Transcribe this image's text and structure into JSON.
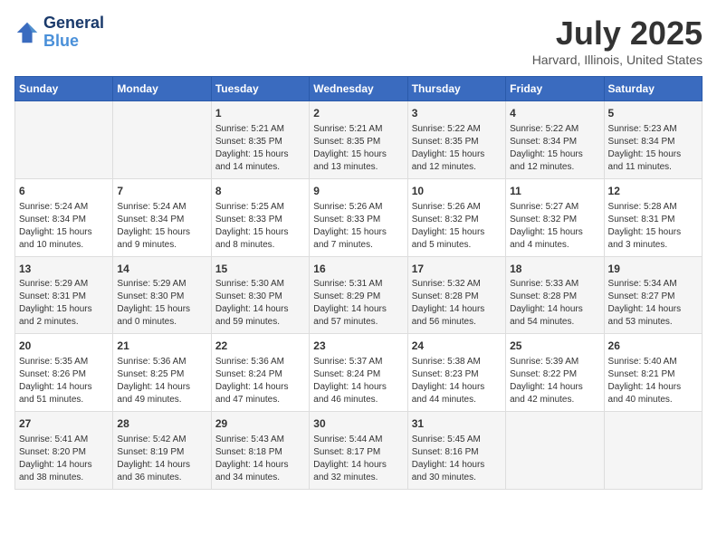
{
  "header": {
    "logo_line1": "General",
    "logo_line2": "Blue",
    "title": "July 2025",
    "subtitle": "Harvard, Illinois, United States"
  },
  "days_of_week": [
    "Sunday",
    "Monday",
    "Tuesday",
    "Wednesday",
    "Thursday",
    "Friday",
    "Saturday"
  ],
  "weeks": [
    [
      {
        "day": "",
        "info": ""
      },
      {
        "day": "",
        "info": ""
      },
      {
        "day": "1",
        "info": "Sunrise: 5:21 AM\nSunset: 8:35 PM\nDaylight: 15 hours\nand 14 minutes."
      },
      {
        "day": "2",
        "info": "Sunrise: 5:21 AM\nSunset: 8:35 PM\nDaylight: 15 hours\nand 13 minutes."
      },
      {
        "day": "3",
        "info": "Sunrise: 5:22 AM\nSunset: 8:35 PM\nDaylight: 15 hours\nand 12 minutes."
      },
      {
        "day": "4",
        "info": "Sunrise: 5:22 AM\nSunset: 8:34 PM\nDaylight: 15 hours\nand 12 minutes."
      },
      {
        "day": "5",
        "info": "Sunrise: 5:23 AM\nSunset: 8:34 PM\nDaylight: 15 hours\nand 11 minutes."
      }
    ],
    [
      {
        "day": "6",
        "info": "Sunrise: 5:24 AM\nSunset: 8:34 PM\nDaylight: 15 hours\nand 10 minutes."
      },
      {
        "day": "7",
        "info": "Sunrise: 5:24 AM\nSunset: 8:34 PM\nDaylight: 15 hours\nand 9 minutes."
      },
      {
        "day": "8",
        "info": "Sunrise: 5:25 AM\nSunset: 8:33 PM\nDaylight: 15 hours\nand 8 minutes."
      },
      {
        "day": "9",
        "info": "Sunrise: 5:26 AM\nSunset: 8:33 PM\nDaylight: 15 hours\nand 7 minutes."
      },
      {
        "day": "10",
        "info": "Sunrise: 5:26 AM\nSunset: 8:32 PM\nDaylight: 15 hours\nand 5 minutes."
      },
      {
        "day": "11",
        "info": "Sunrise: 5:27 AM\nSunset: 8:32 PM\nDaylight: 15 hours\nand 4 minutes."
      },
      {
        "day": "12",
        "info": "Sunrise: 5:28 AM\nSunset: 8:31 PM\nDaylight: 15 hours\nand 3 minutes."
      }
    ],
    [
      {
        "day": "13",
        "info": "Sunrise: 5:29 AM\nSunset: 8:31 PM\nDaylight: 15 hours\nand 2 minutes."
      },
      {
        "day": "14",
        "info": "Sunrise: 5:29 AM\nSunset: 8:30 PM\nDaylight: 15 hours\nand 0 minutes."
      },
      {
        "day": "15",
        "info": "Sunrise: 5:30 AM\nSunset: 8:30 PM\nDaylight: 14 hours\nand 59 minutes."
      },
      {
        "day": "16",
        "info": "Sunrise: 5:31 AM\nSunset: 8:29 PM\nDaylight: 14 hours\nand 57 minutes."
      },
      {
        "day": "17",
        "info": "Sunrise: 5:32 AM\nSunset: 8:28 PM\nDaylight: 14 hours\nand 56 minutes."
      },
      {
        "day": "18",
        "info": "Sunrise: 5:33 AM\nSunset: 8:28 PM\nDaylight: 14 hours\nand 54 minutes."
      },
      {
        "day": "19",
        "info": "Sunrise: 5:34 AM\nSunset: 8:27 PM\nDaylight: 14 hours\nand 53 minutes."
      }
    ],
    [
      {
        "day": "20",
        "info": "Sunrise: 5:35 AM\nSunset: 8:26 PM\nDaylight: 14 hours\nand 51 minutes."
      },
      {
        "day": "21",
        "info": "Sunrise: 5:36 AM\nSunset: 8:25 PM\nDaylight: 14 hours\nand 49 minutes."
      },
      {
        "day": "22",
        "info": "Sunrise: 5:36 AM\nSunset: 8:24 PM\nDaylight: 14 hours\nand 47 minutes."
      },
      {
        "day": "23",
        "info": "Sunrise: 5:37 AM\nSunset: 8:24 PM\nDaylight: 14 hours\nand 46 minutes."
      },
      {
        "day": "24",
        "info": "Sunrise: 5:38 AM\nSunset: 8:23 PM\nDaylight: 14 hours\nand 44 minutes."
      },
      {
        "day": "25",
        "info": "Sunrise: 5:39 AM\nSunset: 8:22 PM\nDaylight: 14 hours\nand 42 minutes."
      },
      {
        "day": "26",
        "info": "Sunrise: 5:40 AM\nSunset: 8:21 PM\nDaylight: 14 hours\nand 40 minutes."
      }
    ],
    [
      {
        "day": "27",
        "info": "Sunrise: 5:41 AM\nSunset: 8:20 PM\nDaylight: 14 hours\nand 38 minutes."
      },
      {
        "day": "28",
        "info": "Sunrise: 5:42 AM\nSunset: 8:19 PM\nDaylight: 14 hours\nand 36 minutes."
      },
      {
        "day": "29",
        "info": "Sunrise: 5:43 AM\nSunset: 8:18 PM\nDaylight: 14 hours\nand 34 minutes."
      },
      {
        "day": "30",
        "info": "Sunrise: 5:44 AM\nSunset: 8:17 PM\nDaylight: 14 hours\nand 32 minutes."
      },
      {
        "day": "31",
        "info": "Sunrise: 5:45 AM\nSunset: 8:16 PM\nDaylight: 14 hours\nand 30 minutes."
      },
      {
        "day": "",
        "info": ""
      },
      {
        "day": "",
        "info": ""
      }
    ]
  ]
}
